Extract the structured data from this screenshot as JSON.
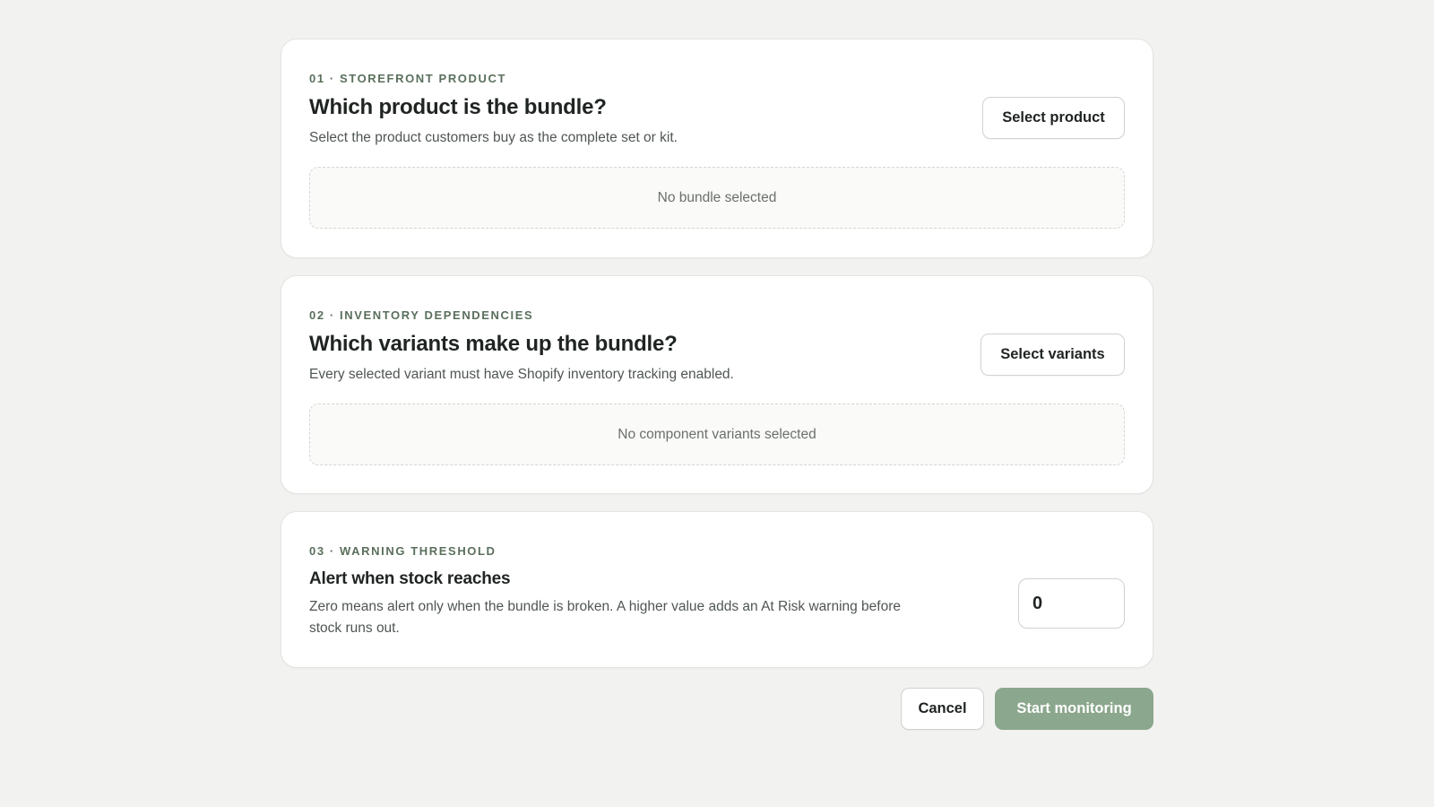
{
  "steps": [
    {
      "eyebrow": "01 · STOREFRONT PRODUCT",
      "title": "Which product is the bundle?",
      "description": "Select the product customers buy as the complete set or kit.",
      "button_label": "Select product",
      "empty_text": "No bundle selected"
    },
    {
      "eyebrow": "02 · INVENTORY DEPENDENCIES",
      "title": "Which variants make up the bundle?",
      "description": "Every selected variant must have Shopify inventory tracking enabled.",
      "button_label": "Select variants",
      "empty_text": "No component variants selected"
    },
    {
      "eyebrow": "03 · WARNING THRESHOLD",
      "title": "Alert when stock reaches",
      "description": "Zero means alert only when the bundle is broken. A higher value adds an At Risk warning before stock runs out.",
      "input_value": "0"
    }
  ],
  "actions": {
    "cancel_label": "Cancel",
    "start_label": "Start monitoring"
  },
  "colors": {
    "background": "#f2f2f0",
    "eyebrow": "#5a6f5c",
    "primary_disabled": "#8ba78d"
  }
}
